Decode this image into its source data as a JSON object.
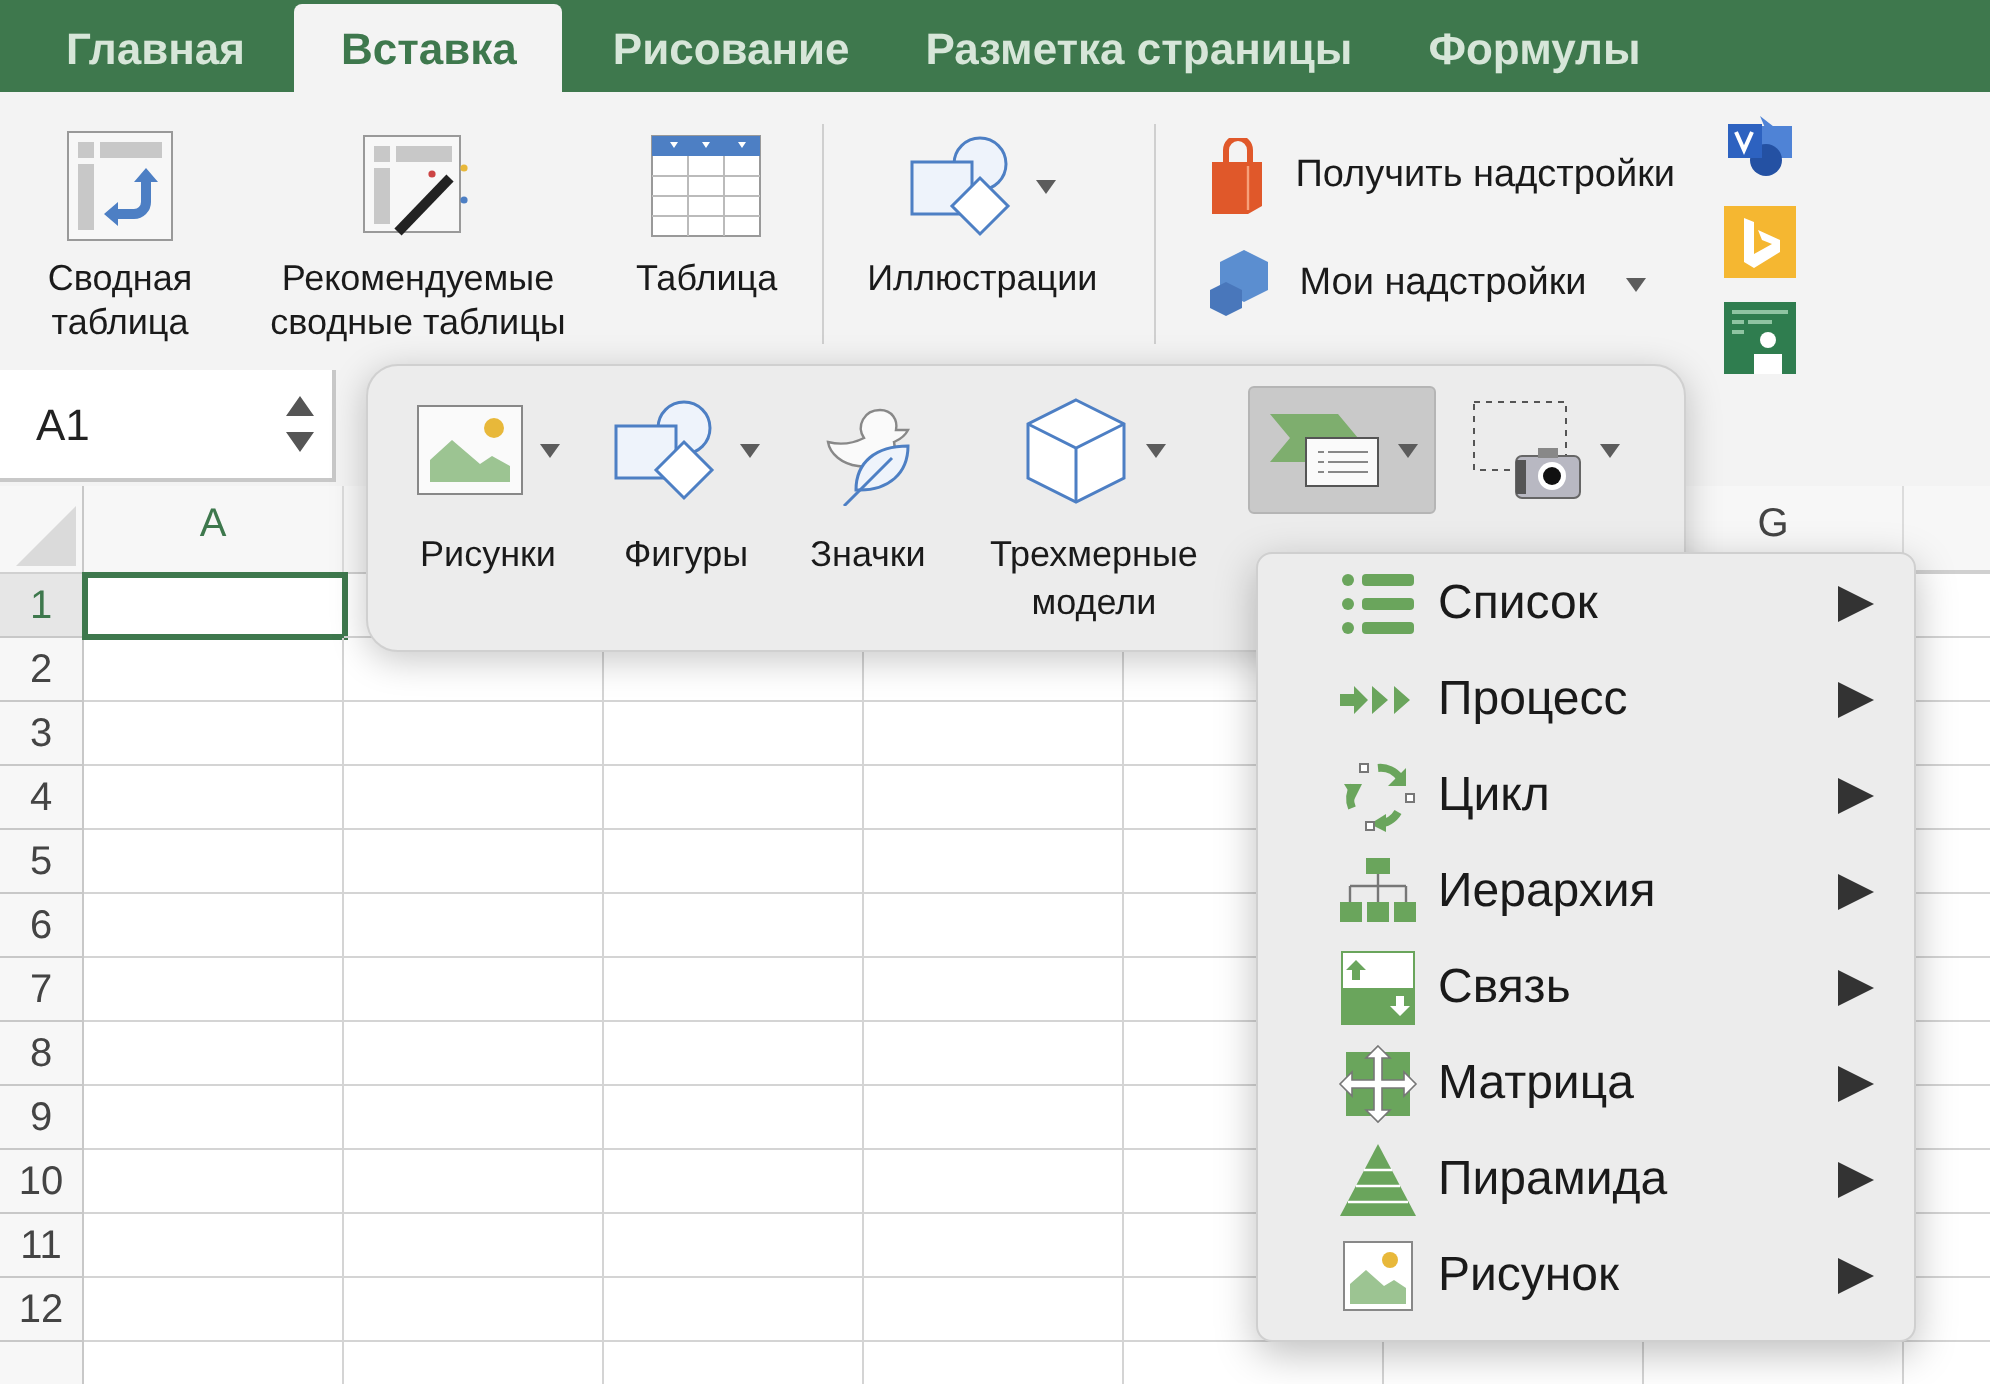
{
  "tabs": [
    {
      "label": "Главная",
      "selected": false
    },
    {
      "label": "Вставка",
      "selected": true
    },
    {
      "label": "Рисование",
      "selected": false
    },
    {
      "label": "Разметка страницы",
      "selected": false
    },
    {
      "label": "Формулы",
      "selected": false
    }
  ],
  "ribbon": {
    "large_buttons": [
      {
        "kind": "pivot",
        "label": "Сводная таблица",
        "dropdown": false
      },
      {
        "kind": "recommended",
        "label": "Рекомендуемые сводные таблицы",
        "dropdown": false
      },
      {
        "kind": "table",
        "label": "Таблица",
        "dropdown": false
      },
      {
        "kind": "illustrations",
        "label": "Иллюстрации",
        "dropdown": true
      }
    ],
    "addins": [
      {
        "kind": "store",
        "label": "Получить надстройки",
        "dropdown": false
      },
      {
        "kind": "mine",
        "label": "Мои надстройки",
        "dropdown": true
      }
    ],
    "apps": [
      {
        "kind": "visio"
      },
      {
        "kind": "bing"
      },
      {
        "kind": "people"
      }
    ]
  },
  "name_box": {
    "value": "A1"
  },
  "sheet": {
    "columns": [
      {
        "label": "A",
        "selected": true
      },
      {
        "label": "G",
        "selected": false
      }
    ],
    "rows": [
      {
        "label": "1",
        "selected": true
      },
      {
        "label": "2",
        "selected": false
      },
      {
        "label": "3",
        "selected": false
      },
      {
        "label": "4",
        "selected": false
      },
      {
        "label": "5",
        "selected": false
      },
      {
        "label": "6",
        "selected": false
      },
      {
        "label": "7",
        "selected": false
      },
      {
        "label": "8",
        "selected": false
      },
      {
        "label": "9",
        "selected": false
      },
      {
        "label": "10",
        "selected": false
      },
      {
        "label": "11",
        "selected": false
      },
      {
        "label": "12",
        "selected": false
      }
    ]
  },
  "illustrations_popup": {
    "items": [
      {
        "kind": "pictures",
        "label": "Рисунки",
        "dropdown": true,
        "selected": false
      },
      {
        "kind": "shapes",
        "label": "Фигуры",
        "dropdown": true,
        "selected": false
      },
      {
        "kind": "icons",
        "label": "Значки",
        "dropdown": false,
        "selected": false
      },
      {
        "kind": "models",
        "label": "Трехмерные модели",
        "dropdown": true,
        "selected": false
      },
      {
        "kind": "smartart",
        "dropdown": true,
        "selected": true
      },
      {
        "kind": "screenshot",
        "dropdown": true,
        "selected": false
      }
    ]
  },
  "smartart_menu": {
    "items": [
      {
        "kind": "list",
        "label": "Список"
      },
      {
        "kind": "process",
        "label": "Процесс"
      },
      {
        "kind": "cycle",
        "label": "Цикл"
      },
      {
        "kind": "hierarchy",
        "label": "Иерархия"
      },
      {
        "kind": "relationship",
        "label": "Связь"
      },
      {
        "kind": "matrix",
        "label": "Матрица"
      },
      {
        "kind": "pyramid",
        "label": "Пирамида"
      },
      {
        "kind": "picture",
        "label": "Рисунок"
      }
    ]
  }
}
